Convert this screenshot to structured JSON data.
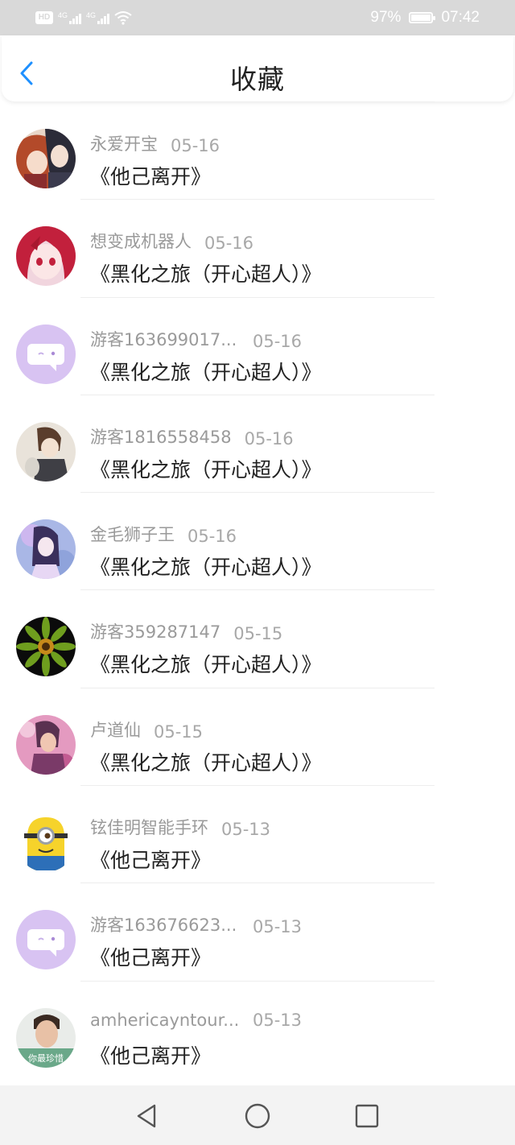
{
  "status_bar": {
    "hd_label": "HD",
    "network_1": "4G",
    "network_2": "4G",
    "battery_percent": "97%",
    "battery_level": 0.97,
    "time": "07:42"
  },
  "header": {
    "title": "收藏",
    "back_icon": "chevron-left-icon"
  },
  "colors": {
    "accent": "#1E90FF",
    "status_bar": "#d9d9d9",
    "default_avatar": "#d8c3f2"
  },
  "favorites": [
    {
      "user": "永爱开宝",
      "date": "05-16",
      "work": "《他己离开》",
      "avatar": "anime-couple-avatar"
    },
    {
      "user": "想变成机器人",
      "date": "05-16",
      "work": "《黑化之旅（开心超人）》",
      "avatar": "anime-girl-avatar"
    },
    {
      "user": "游客163699017...",
      "date": "05-16",
      "work": "《黑化之旅（开心超人）》",
      "avatar": "default-chat-avatar"
    },
    {
      "user": "游客1816558458",
      "date": "05-16",
      "work": "《黑化之旅（开心超人）》",
      "avatar": "anime-boy-avatar"
    },
    {
      "user": "金毛狮子王",
      "date": "05-16",
      "work": "《黑化之旅（开心超人）》",
      "avatar": "fantasy-girl-avatar"
    },
    {
      "user": "游客359287147",
      "date": "05-15",
      "work": "《黑化之旅（开心超人）》",
      "avatar": "green-flower-avatar"
    },
    {
      "user": "卢道仙",
      "date": "05-15",
      "work": "《黑化之旅（开心超人）》",
      "avatar": "pink-anime-avatar"
    },
    {
      "user": "铉佳明智能手环",
      "date": "05-13",
      "work": "《他己离开》",
      "avatar": "minion-avatar"
    },
    {
      "user": "游客163676623...",
      "date": "05-13",
      "work": "《他己离开》",
      "avatar": "default-chat-avatar"
    },
    {
      "user": "amhericayntour...",
      "date": "05-13",
      "work": "《他己离开》",
      "avatar": "photo-man-avatar",
      "avatar_caption": "你最珍惜"
    }
  ],
  "nav_bar": {
    "back": "triangle-back-icon",
    "home": "circle-home-icon",
    "recents": "square-recents-icon"
  }
}
